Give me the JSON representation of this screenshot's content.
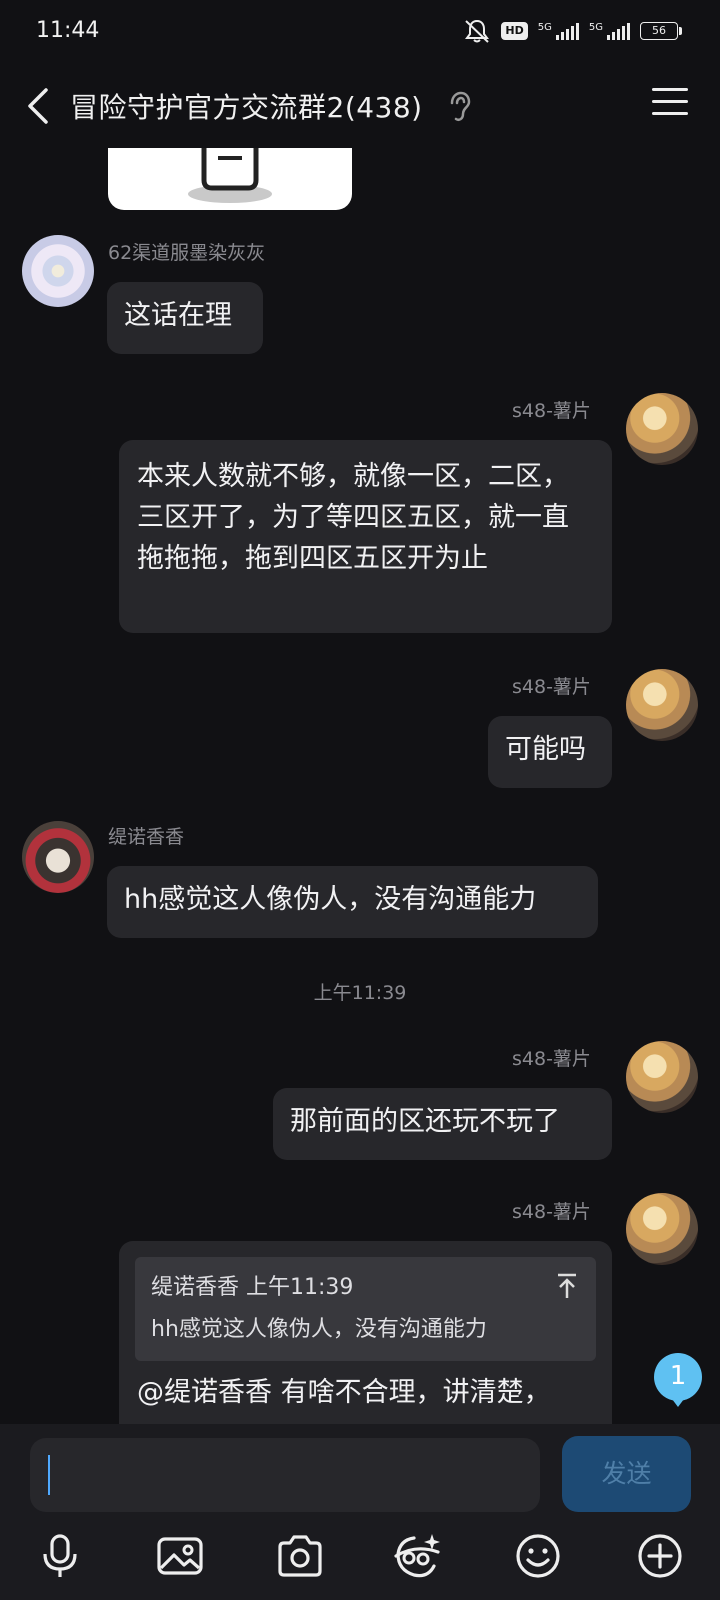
{
  "status_bar": {
    "time": "11:44",
    "hd": "HD",
    "net1": "5G",
    "net2": "5G",
    "battery": "56"
  },
  "header": {
    "title": "冒险守护官方交流群2(438)"
  },
  "messages": [
    {
      "sender": "62渠道服墨染灰灰",
      "text": "这话在理"
    },
    {
      "sender": "s48-薯片",
      "text": "本来人数就不够，就像一区，二区，三区开了，为了等四区五区，就一直拖拖拖，拖到四区五区开为止"
    },
    {
      "sender": "s48-薯片",
      "text": "可能吗"
    },
    {
      "sender": "缇诺香香",
      "text": "hh感觉这人像伪人，没有沟通能力"
    },
    {
      "sender": "s48-薯片",
      "text": "那前面的区还玩不玩了"
    },
    {
      "sender": "s48-薯片",
      "text": "@缇诺香香 有啥不合理，讲清楚，"
    }
  ],
  "timestamp": "上午11:39",
  "quote": {
    "head": "缇诺香香  上午11:39",
    "text": "hh感觉这人像伪人，没有沟通能力"
  },
  "unread_badge": "1",
  "input": {
    "value": "",
    "send_label": "发送"
  },
  "toolbar": [
    "mic-icon",
    "image-icon",
    "camera-icon",
    "sticker-icon",
    "emoji-icon",
    "plus-icon"
  ],
  "colors": {
    "background": "#111114",
    "bubble": "#27272b",
    "send_button": "#1d4a74",
    "badge": "#5fc1f2"
  }
}
